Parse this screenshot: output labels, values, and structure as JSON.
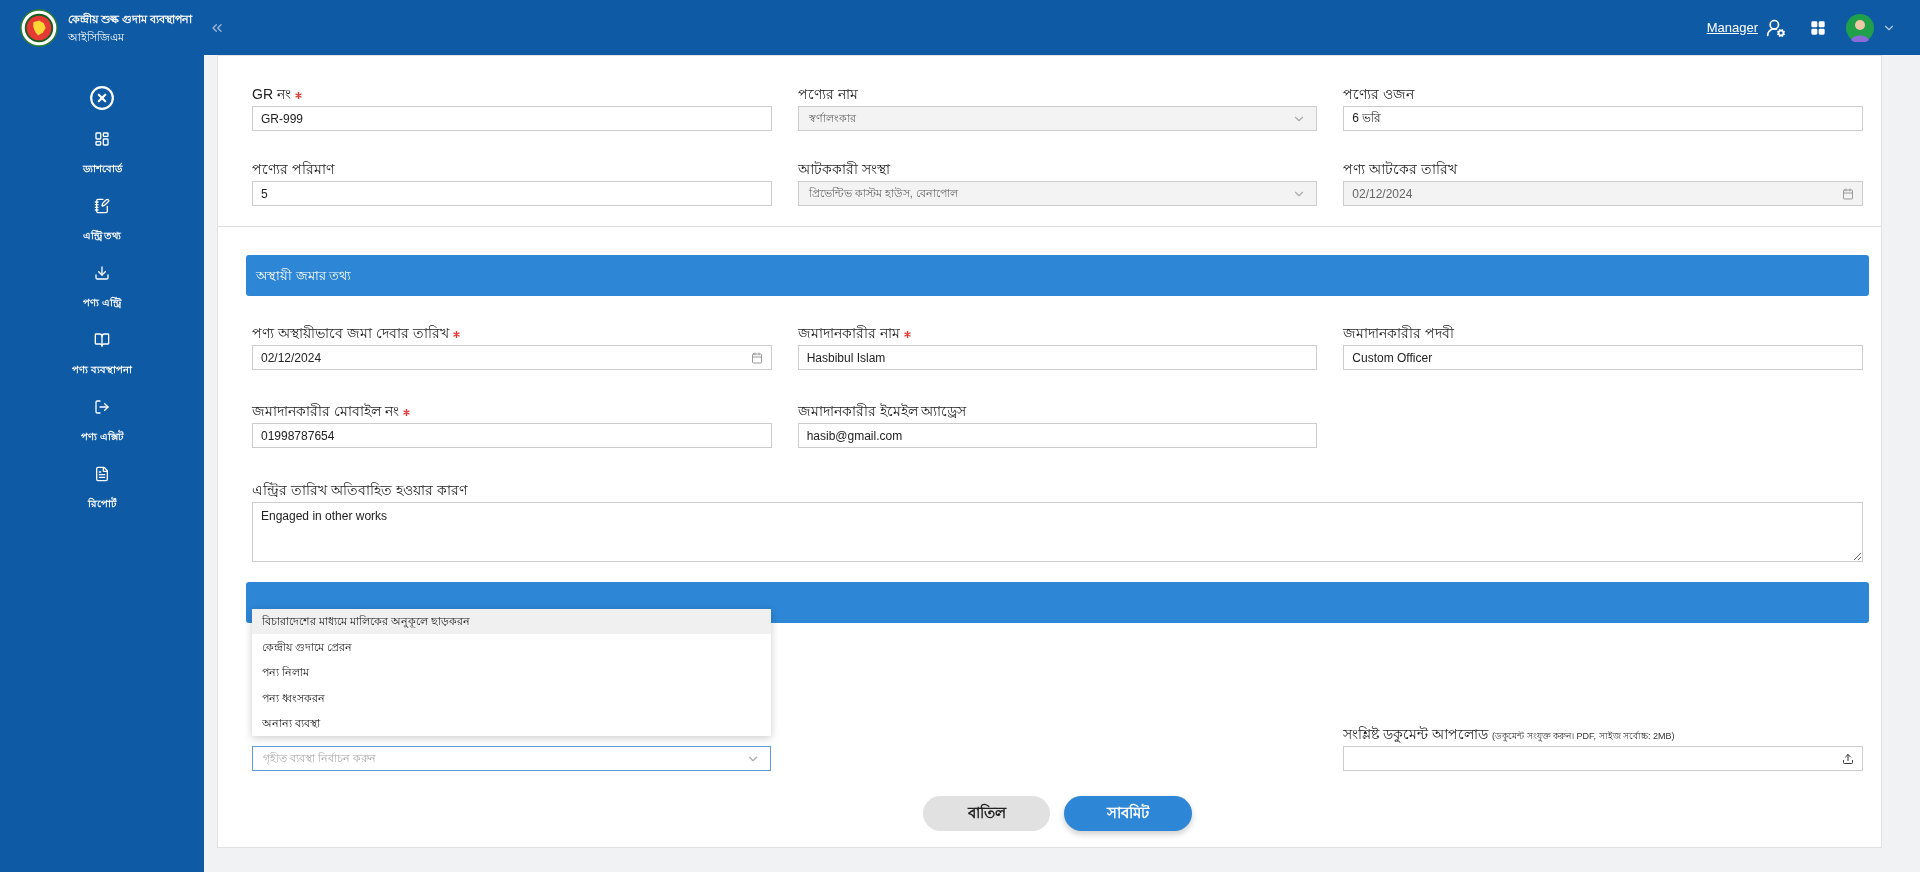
{
  "header": {
    "app_title": "কেন্দ্রীয় শুল্ক গুদাম ব্যবস্থাপনা",
    "app_subtitle": "আইসিজিএম",
    "user_role": "Manager"
  },
  "sidebar": {
    "items": [
      {
        "label": "ড্যাশবোর্ড",
        "kind": "dashboard"
      },
      {
        "label": "এন্ট্রি তথ্য",
        "kind": "entry"
      },
      {
        "label": "পণ্য এন্ট্রি",
        "kind": "download"
      },
      {
        "label": "পণ্য ব্যবস্থাপনা",
        "kind": "book"
      },
      {
        "label": "পণ্য এক্সিট",
        "kind": "exit"
      },
      {
        "label": "রিপোর্ট",
        "kind": "report"
      }
    ]
  },
  "goods_fields": [
    {
      "label": "GR নং",
      "required": true,
      "kind": "text",
      "value": "GR-999",
      "disabled": false
    },
    {
      "label": "পণ্যের নাম",
      "required": false,
      "kind": "select",
      "value": "স্বর্ণালংকার",
      "disabled": true
    },
    {
      "label": "পণ্যের ওজন",
      "required": false,
      "kind": "text",
      "value": "6 ভরি",
      "disabled": false
    },
    {
      "label": "পণ্যের পরিমাণ",
      "required": false,
      "kind": "text",
      "value": "5",
      "disabled": false
    },
    {
      "label": "আটককারী সংস্থা",
      "required": false,
      "kind": "select",
      "value": "প্রিভেন্টিভ কাস্টম হাউস, বেনাপোল",
      "disabled": true
    },
    {
      "label": "পণ্য আটকের তারিখ",
      "required": false,
      "kind": "date",
      "value": "02/12/2024",
      "disabled": true
    }
  ],
  "deposit_section": {
    "title": "অস্থায়ী জমার তথ্য",
    "fields": [
      {
        "label": "পণ্য অস্থায়ীভাবে জমা দেবার তারিখ",
        "required": true,
        "kind": "date",
        "value": "02/12/2024",
        "disabled": false
      },
      {
        "label": "জমাদানকারীর নাম",
        "required": true,
        "kind": "text",
        "value": "Hasbibul Islam",
        "disabled": false
      },
      {
        "label": "জমাদানকারীর পদবী",
        "required": false,
        "kind": "text",
        "value": "Custom Officer",
        "disabled": false
      },
      {
        "label": "জমাদানকারীর মোবাইল নং",
        "required": true,
        "kind": "text",
        "value": "01998787654",
        "disabled": false
      },
      {
        "label": "জমাদানকারীর ইমেইল অ্যাড্রেস",
        "required": false,
        "kind": "text",
        "value": "hasib@gmail.com",
        "disabled": false
      }
    ],
    "delay_reason": {
      "label": "এন্ট্রির তারিখ অতিবাহিত হওয়ার কারণ",
      "value": "Engaged in other works"
    }
  },
  "disposal_section": {
    "action_select": {
      "placeholder": "গৃহীত ব্যবস্থা নির্বাচন করুন",
      "expanded": true,
      "options": [
        {
          "label": "বিচারাদেশের মাধ্যমে মালিকের অনুকূলে ছাড়করন",
          "selected": true
        },
        {
          "label": "কেন্দ্রীয় গুদামে প্রেরন",
          "selected": false
        },
        {
          "label": "পন্য নিলাম",
          "selected": false
        },
        {
          "label": "পন্য ধ্বংসকরন",
          "selected": false
        },
        {
          "label": "অনান্য ব্যবস্থা",
          "selected": false
        }
      ]
    },
    "upload": {
      "label": "সংশ্লিষ্ট ডকুমেন্ট আপলোড",
      "hint": "(ডকুমেন্ট সংযুক্ত করুন। PDF, সাইজ সর্বোচ্চ: 2MB)"
    }
  },
  "buttons": {
    "cancel": "বাতিল",
    "submit": "সাবমিট"
  }
}
